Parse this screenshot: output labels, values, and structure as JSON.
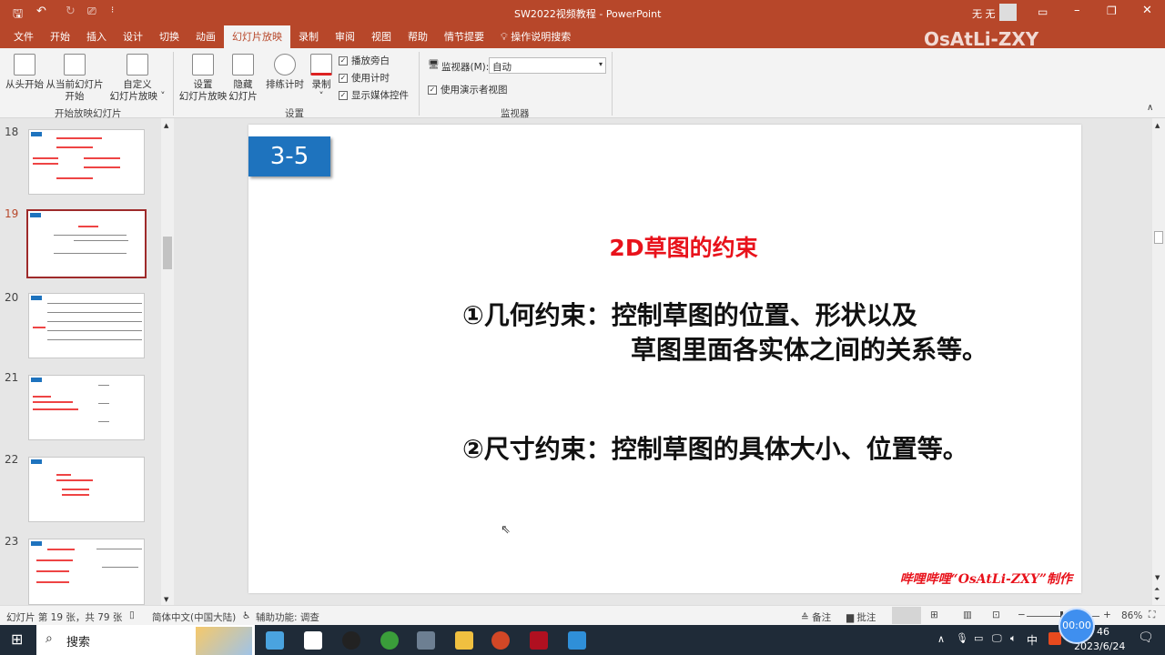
{
  "title": "SW2022视频教程  -  PowerPoint",
  "user": "无 无",
  "watermark": "OsAtLi-ZXY",
  "menu": [
    "文件",
    "开始",
    "插入",
    "设计",
    "切换",
    "动画",
    "幻灯片放映",
    "录制",
    "审阅",
    "视图",
    "帮助",
    "情节提要"
  ],
  "active_menu": 6,
  "search_label": "操作说明搜索",
  "ribbon": {
    "from_start": "从头开始",
    "from_current_1": "从当前幻灯片",
    "from_current_2": "开始",
    "custom_1": "自定义",
    "custom_2": "幻灯片放映 ˅",
    "group1": "开始放映幻灯片",
    "setup_1": "设置",
    "setup_2": "幻灯片放映",
    "hide_1": "隐藏",
    "hide_2": "幻灯片",
    "rehearse": "排练计时",
    "record": "录制",
    "record_arrow": "˅",
    "cb_narration": "播放旁白",
    "cb_timing": "使用计时",
    "cb_media": "显示媒体控件",
    "group2": "设置",
    "monitor_label": "监视器(M):",
    "monitor_value": "自动",
    "presenter_view": "使用演示者视图",
    "group3": "监视器"
  },
  "slides": [
    {
      "num": "18"
    },
    {
      "num": "19"
    },
    {
      "num": "20"
    },
    {
      "num": "21"
    },
    {
      "num": "22"
    },
    {
      "num": "23"
    }
  ],
  "selected_slide": "19",
  "slide": {
    "badge": "3-5",
    "title": "2D草图的约束",
    "line1": "①几何约束：控制草图的位置、形状以及",
    "line2": "草图里面各实体之间的关系等。",
    "line3": "②尺寸约束：控制草图的具体大小、位置等。",
    "footer": "哔哩哔哩“OsAtLi-ZXY”制作"
  },
  "status": {
    "slide_info": "幻灯片 第 19 张，共 79 张",
    "language": "简体中文(中国大陆)",
    "accessibility": "辅助功能: 调查",
    "notes": "备注",
    "comments": "批注",
    "zoom": "86%"
  },
  "taskbar": {
    "search": "搜索",
    "time": "46",
    "date": "2023/6/24",
    "ime": "中",
    "timer": "00:00"
  },
  "colors": {
    "accent": "#b7472a",
    "title_red": "#e8121b",
    "badge_blue": "#1e73be"
  }
}
